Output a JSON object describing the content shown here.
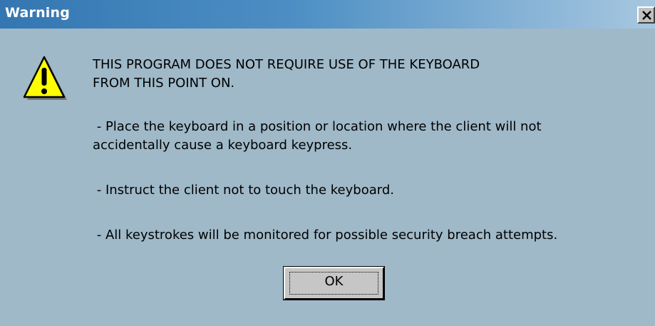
{
  "window": {
    "title": "Warning",
    "close_glyph": "×",
    "titlebar_color": "#3476b1",
    "body_color": "#9fb9c8"
  },
  "icon": {
    "name": "warning-triangle-icon",
    "glyph": "!",
    "fill": "#ffff00"
  },
  "message": {
    "heading_line1": "THIS PROGRAM DOES NOT REQUIRE USE OF THE KEYBOARD",
    "heading_line2": "FROM THIS POINT ON.",
    "place_line1": " - Place the keyboard in a position or location where the client will not",
    "place_line2": "accidentally cause a keyboard keypress.",
    "instruct": " - Instruct the client not to touch the keyboard.",
    "monitor": " - All keystrokes will be monitored for possible security breach attempts."
  },
  "buttons": {
    "ok_label": "OK"
  }
}
